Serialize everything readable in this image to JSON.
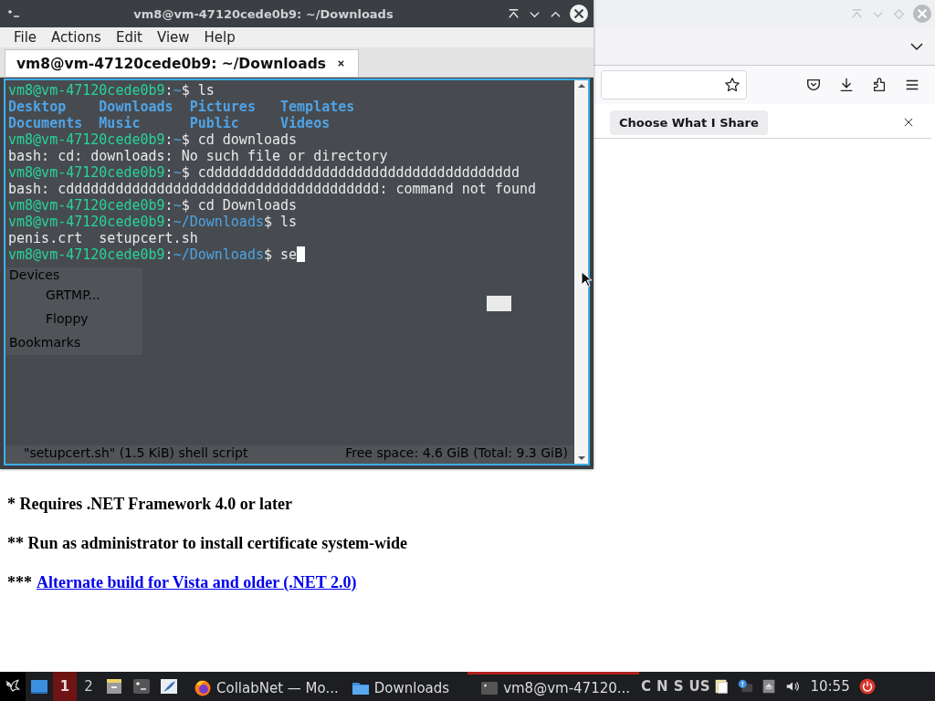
{
  "browser": {
    "notification": {
      "button": "Choose What I Share"
    },
    "paragraphs": [
      {
        "text": "* Requires .NET Framework 4.0 or later"
      },
      {
        "text": "** Run as administrator to install certificate system-wide"
      },
      {
        "text": "***",
        "link": "Alternate build for Vista and older (.NET 2.0)"
      }
    ]
  },
  "terminal": {
    "title": "vm8@vm-47120cede0b9: ~/Downloads",
    "menu": [
      "File",
      "Actions",
      "Edit",
      "View",
      "Help"
    ],
    "tabs": [
      {
        "label": "vm8@vm-47120cede0b9: ~/Downloads",
        "selected": true
      }
    ],
    "lines": [
      {
        "segments": [
          {
            "kind": "user",
            "text": "vm8@vm-47120cede0b9"
          },
          {
            "kind": "plain",
            "text": ":"
          },
          {
            "kind": "path",
            "text": "~"
          },
          {
            "kind": "plain",
            "text": "$ ls"
          }
        ]
      },
      {
        "segments": [
          {
            "kind": "dir",
            "text": "Desktop    Downloads  Pictures   Templates"
          }
        ]
      },
      {
        "segments": [
          {
            "kind": "dir",
            "text": "Documents  Music      Public     Videos"
          }
        ]
      },
      {
        "segments": [
          {
            "kind": "user",
            "text": "vm8@vm-47120cede0b9"
          },
          {
            "kind": "plain",
            "text": ":"
          },
          {
            "kind": "path",
            "text": "~"
          },
          {
            "kind": "plain",
            "text": "$ cd downloads"
          }
        ]
      },
      {
        "segments": [
          {
            "kind": "plain",
            "text": "bash: cd: downloads: No such file or directory"
          }
        ]
      },
      {
        "segments": [
          {
            "kind": "user",
            "text": "vm8@vm-47120cede0b9"
          },
          {
            "kind": "plain",
            "text": ":"
          },
          {
            "kind": "path",
            "text": "~"
          },
          {
            "kind": "plain",
            "text": "$ cdddddddddddddddddddddddddddddddddddddd"
          }
        ]
      },
      {
        "segments": [
          {
            "kind": "plain",
            "text": "bash: cdddddddddddddddddddddddddddddddddddddd: command not found"
          }
        ]
      },
      {
        "segments": [
          {
            "kind": "user",
            "text": "vm8@vm-47120cede0b9"
          },
          {
            "kind": "plain",
            "text": ":"
          },
          {
            "kind": "path",
            "text": "~"
          },
          {
            "kind": "plain",
            "text": "$ cd Downloads"
          }
        ]
      },
      {
        "segments": [
          {
            "kind": "user",
            "text": "vm8@vm-47120cede0b9"
          },
          {
            "kind": "plain",
            "text": ":"
          },
          {
            "kind": "path",
            "text": "~/Downloads"
          },
          {
            "kind": "plain",
            "text": "$ ls"
          }
        ]
      },
      {
        "segments": [
          {
            "kind": "plain",
            "text": "penis.crt  setupcert.sh"
          }
        ]
      },
      {
        "segments": [
          {
            "kind": "user",
            "text": "vm8@vm-47120cede0b9"
          },
          {
            "kind": "plain",
            "text": ":"
          },
          {
            "kind": "path",
            "text": "~/Downloads"
          },
          {
            "kind": "plain",
            "text": "$ se"
          }
        ],
        "cursor": true
      }
    ],
    "behind": {
      "sidebar": [
        {
          "kind": "heading",
          "text": "Devices"
        },
        {
          "kind": "item",
          "text": "GRTMP..."
        },
        {
          "kind": "item",
          "text": "Floppy"
        },
        {
          "kind": "heading",
          "text": "Bookmarks"
        }
      ],
      "status_left": "\"setupcert.sh\" (1.5 KiB) shell script",
      "status_right": "Free space: 4.6 GiB (Total: 9.3 GiB)"
    }
  },
  "taskbar": {
    "workspaces": [
      {
        "label": "1",
        "selected": true
      },
      {
        "label": "2",
        "selected": false
      }
    ],
    "tasks": [
      {
        "kind": "browser",
        "label": "CollabNet — Mo...",
        "selected": false
      },
      {
        "kind": "folder",
        "label": "Downloads",
        "selected": false
      },
      {
        "kind": "terminal",
        "label": "vm8@vm-47120...",
        "selected": true
      }
    ],
    "indicators": [
      "C",
      "N",
      "S",
      "US"
    ],
    "clock": "10:55"
  }
}
